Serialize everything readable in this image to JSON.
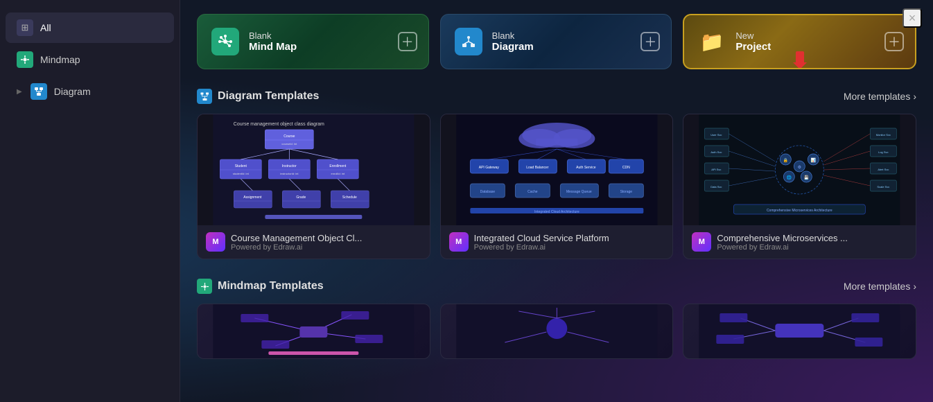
{
  "close_button": "×",
  "sidebar": {
    "items": [
      {
        "id": "all",
        "label": "All",
        "icon": "⊞",
        "active": true
      },
      {
        "id": "mindmap",
        "label": "Mindmap",
        "icon": "◈"
      },
      {
        "id": "diagram",
        "label": "Diagram",
        "icon": "◉",
        "expandable": true
      }
    ]
  },
  "quick_cards": [
    {
      "id": "blank-mindmap",
      "line1": "Blank",
      "line2": "Mind Map",
      "icon": "✦",
      "type": "mindmap"
    },
    {
      "id": "blank-diagram",
      "line1": "Blank",
      "line2": "Diagram",
      "icon": "⬡",
      "type": "diagram"
    },
    {
      "id": "new-project",
      "line1": "New",
      "line2": "Project",
      "icon": "📁",
      "type": "new-project"
    }
  ],
  "sections": [
    {
      "id": "diagram-templates",
      "title": "Diagram Templates",
      "icon_type": "diagram",
      "more_label": "More templates",
      "templates": [
        {
          "name": "Course Management Object Cl...",
          "powered_by": "Powered by Edraw.ai",
          "type": "class-diagram"
        },
        {
          "name": "Integrated Cloud Service Platform",
          "powered_by": "Powered by Edraw.ai",
          "type": "cloud-diagram"
        },
        {
          "name": "Comprehensive Microservices ...",
          "powered_by": "Powered by Edraw.ai",
          "type": "micro-diagram"
        }
      ]
    },
    {
      "id": "mindmap-templates",
      "title": "Mindmap Templates",
      "icon_type": "mindmap",
      "more_label": "More templates",
      "templates": []
    }
  ]
}
